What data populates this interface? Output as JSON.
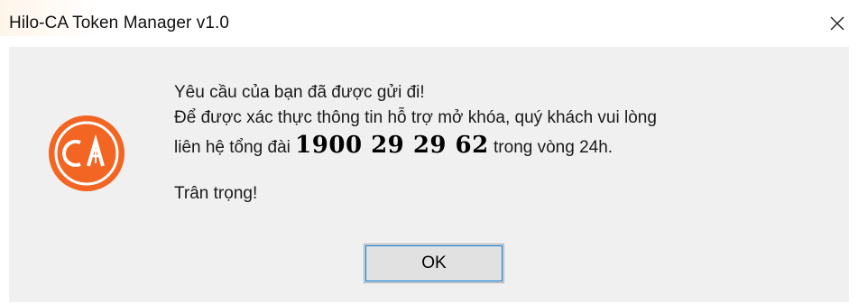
{
  "window": {
    "title": "Hilo-CA Token Manager v1.0",
    "close_icon": "close-icon"
  },
  "dialog": {
    "icon": "ca-logo-icon",
    "line1": "Yêu cầu của bạn đã được gửi đi!",
    "line2": "Để được xác thực thông tin hỗ trợ mở khóa, quý khách vui lòng",
    "line3_prefix": "liên hệ tổng đài",
    "hotline": "1900 29 29 62",
    "line3_suffix": "trong vòng 24h.",
    "closing": "Trân trọng!",
    "ok_label": "OK",
    "logo_text": "CA"
  },
  "colors": {
    "logo_orange": "#f26522",
    "client_bg": "#f0f0f0",
    "button_focus": "#0078d7"
  }
}
